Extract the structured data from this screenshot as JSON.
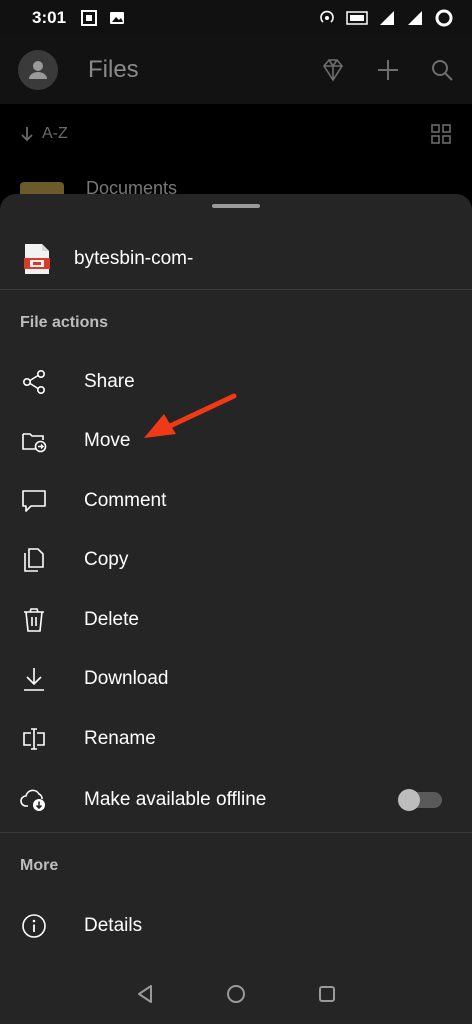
{
  "status_bar": {
    "time": "3:01",
    "left_icons": [
      "screenshot-icon",
      "gallery-icon"
    ],
    "right_icons": [
      "hotspot-icon",
      "volte-icon",
      "signal-icon",
      "signal-4g-icon",
      "battery-icon"
    ]
  },
  "app_bar": {
    "title": "Files",
    "icons": [
      "avatar-icon",
      "premium-diamond-icon",
      "add-icon",
      "search-icon"
    ]
  },
  "sort_bar": {
    "label": "A-Z",
    "icons": [
      "sort-arrow-icon",
      "grid-view-icon"
    ]
  },
  "background_list": {
    "first_item": "Documents"
  },
  "sheet": {
    "file_name": "bytesbin-com-",
    "file_actions_title": "File actions",
    "file_actions": [
      {
        "label": "Share",
        "icon": "share-icon"
      },
      {
        "label": "Move",
        "icon": "move-folder-icon"
      },
      {
        "label": "Comment",
        "icon": "comment-icon"
      },
      {
        "label": "Copy",
        "icon": "copy-icon"
      },
      {
        "label": "Delete",
        "icon": "trash-icon"
      },
      {
        "label": "Download",
        "icon": "download-icon"
      },
      {
        "label": "Rename",
        "icon": "rename-icon"
      },
      {
        "label": "Make available offline",
        "icon": "offline-cloud-icon",
        "toggle_on": false
      }
    ],
    "more_title": "More",
    "more_items": [
      {
        "label": "Details",
        "icon": "info-icon"
      }
    ]
  },
  "annotation": {
    "type": "red-arrow",
    "points_to": "Move",
    "color": "#f03a17"
  },
  "nav_bar": {
    "icons": [
      "back-icon",
      "home-icon",
      "recents-icon"
    ]
  },
  "colors": {
    "sheet_bg": "#252525",
    "text": "#ffffff",
    "section_title": "#bdbdbd",
    "accent_red": "#e2402c"
  }
}
